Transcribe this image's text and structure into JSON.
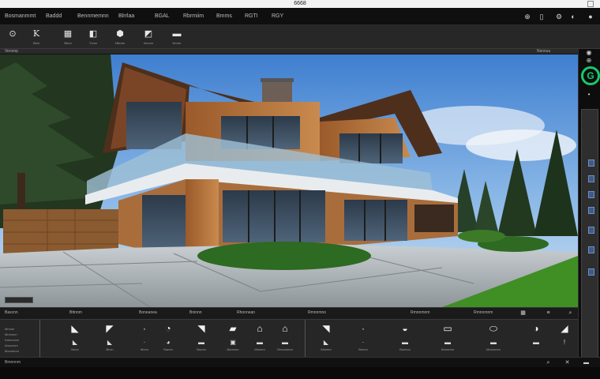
{
  "window": {
    "title": "6668"
  },
  "menu": {
    "items": [
      "Bosmanmmt",
      "Baddd",
      "Bennmemnn",
      "Blrrlaa",
      "BGAL",
      "Rbrmiim",
      "Bmms",
      "RGTI",
      "RGY"
    ]
  },
  "menu_right_icons": [
    "globe-icon",
    "phone-icon",
    "gear-icon",
    "moon-icon"
  ],
  "toolbar": {
    "tools": [
      {
        "icon": "orbit-icon",
        "label": ""
      },
      {
        "icon": "text-icon",
        "label": "Bidn"
      },
      {
        "icon": "grid-icon",
        "label": "Bbun"
      },
      {
        "icon": "layer-icon",
        "label": "Tnnm"
      },
      {
        "icon": "cube-icon",
        "label": "Nlkmm"
      },
      {
        "icon": "roof-icon",
        "label": "Imnnm"
      },
      {
        "icon": "cap-icon",
        "label": "Nmmr"
      }
    ]
  },
  "viewport_header": {
    "left": "Vennnp",
    "right": "Nsnnuu"
  },
  "bottom_header": {
    "labels": [
      "Baxcnn",
      "Bttnnm",
      "Boneanea",
      "Bninnn",
      "Rhonnean",
      "Rmnnmno",
      "Rmnnmnm",
      "Rmnnmnm"
    ]
  },
  "left_list": [
    "Mnnnn",
    "Mmnnnn",
    "Kamoonm",
    "Anocvnm",
    "Mounnnm"
  ],
  "library": [
    {
      "icon": "wall-icon",
      "label": "Nnnn"
    },
    {
      "icon": "door-icon",
      "label": "Bnvn"
    },
    {
      "icon": "window-icon",
      "label": "Mnnn"
    },
    {
      "icon": "stair-icon",
      "label": "Ramm"
    },
    {
      "icon": "roof-tool-icon",
      "label": "Brumn"
    },
    {
      "icon": "house-icon",
      "label": "Bannnm"
    },
    {
      "icon": "slab-icon",
      "label": "Mnnnm"
    },
    {
      "icon": "column-icon",
      "label": "Rmonnmm"
    },
    {
      "icon": "beam-icon",
      "label": "Mmmm"
    },
    {
      "icon": "curtain-icon",
      "label": "Bnnnn"
    },
    {
      "icon": "furniture-icon",
      "label": "Bonnoo"
    },
    {
      "icon": "light-icon",
      "label": "Bnnnmm"
    },
    {
      "icon": "tree-icon",
      "label": "Mnnmmm"
    }
  ],
  "statusbar": {
    "text": "Bmnnnm"
  },
  "right_panel": {
    "logo": "G"
  }
}
